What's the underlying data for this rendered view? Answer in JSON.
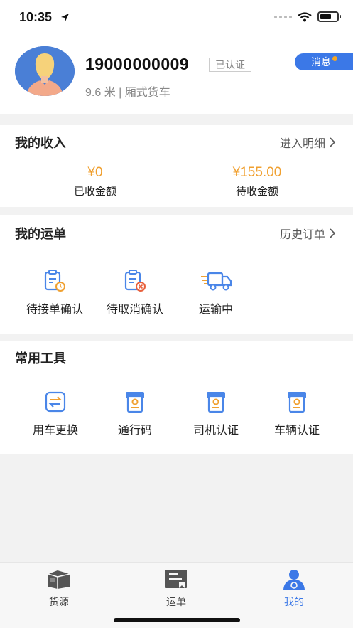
{
  "status_bar": {
    "time": "10:35",
    "battery_level": 0.7
  },
  "profile": {
    "phone": "19000000009",
    "verified_badge": "已认证",
    "vehicle_info": "9.6 米 | 厢式货车",
    "message_button": "消息"
  },
  "income": {
    "title": "我的收入",
    "link": "进入明细",
    "received_amount": "¥0",
    "received_label": "已收金额",
    "pending_amount": "¥155.00",
    "pending_label": "待收金额"
  },
  "waybill": {
    "title": "我的运单",
    "link": "历史订单",
    "items": [
      {
        "label": "待接单确认",
        "icon": "clipboard-clock-icon"
      },
      {
        "label": "待取消确认",
        "icon": "clipboard-cancel-icon"
      },
      {
        "label": "运输中",
        "icon": "truck-icon"
      }
    ]
  },
  "tools": {
    "title": "常用工具",
    "items": [
      {
        "label": "用车更换",
        "icon": "swap-icon"
      },
      {
        "label": "通行码",
        "icon": "pass-code-icon"
      },
      {
        "label": "司机认证",
        "icon": "driver-cert-icon"
      },
      {
        "label": "车辆认证",
        "icon": "vehicle-cert-icon"
      }
    ]
  },
  "tabbar": {
    "tabs": [
      {
        "label": "货源",
        "icon": "cargo-box-icon"
      },
      {
        "label": "运单",
        "icon": "waybill-icon"
      },
      {
        "label": "我的",
        "icon": "user-icon",
        "active": true
      }
    ]
  },
  "colors": {
    "accent": "#3b78e7",
    "amount": "#f0a030",
    "alert": "#f5a623"
  }
}
